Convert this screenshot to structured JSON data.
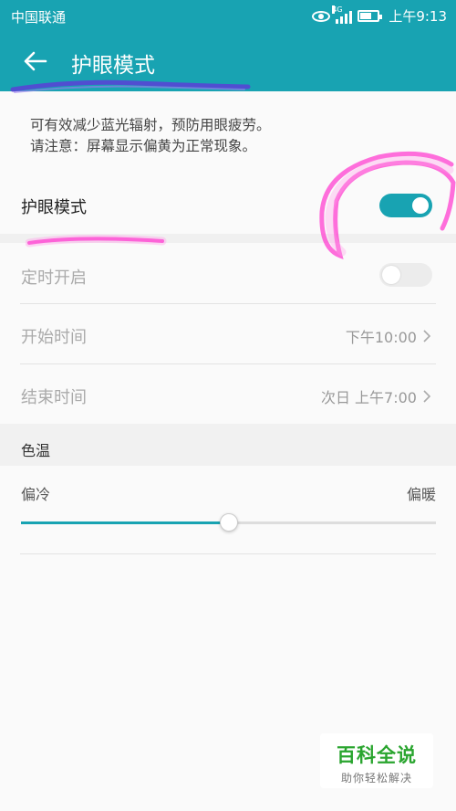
{
  "status_bar": {
    "carrier": "中国联通",
    "network": "4G",
    "time": "上午9:13"
  },
  "header": {
    "title": "护眼模式",
    "background": "#18a3b2"
  },
  "description": {
    "line1": "可有效减少蓝光辐射，预防用眼疲劳。",
    "line2": "请注意：屏幕显示偏黄为正常现象。"
  },
  "eye_comfort": {
    "label": "护眼模式",
    "enabled": true
  },
  "schedule": {
    "label": "定时开启",
    "enabled": false,
    "start": {
      "label": "开始时间",
      "value": "下午10:00"
    },
    "end": {
      "label": "结束时间",
      "value": "次日 上午7:00"
    }
  },
  "color_temp": {
    "section_title": "色温",
    "left_label": "偏冷",
    "right_label": "偏暖",
    "level_fraction": 0.5
  },
  "watermark": {
    "name": "百科全说",
    "tagline": "助你轻松解决"
  },
  "colors": {
    "accent": "#18a3b2",
    "highlight": "#ff4fd8",
    "watermark_green": "#2aa52f"
  }
}
